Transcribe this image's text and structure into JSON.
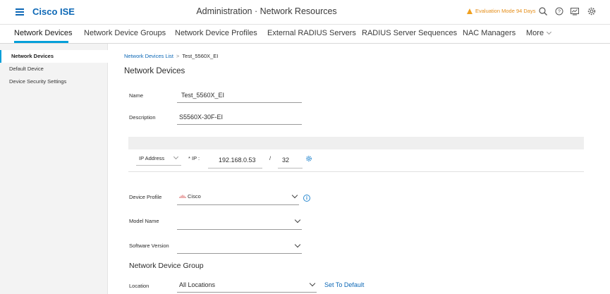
{
  "header": {
    "brand": "Cisco ISE",
    "title": "Administration · Network Resources",
    "eval_text": "Evaluation Mode 94 Days",
    "icons": [
      "search-icon",
      "help-icon",
      "dashboard-icon",
      "settings-icon"
    ],
    "accent": "#049fd9",
    "brand_color": "#0d68b6",
    "warning_color": "#e58d17"
  },
  "tabs": {
    "items": [
      {
        "label": "Network Devices",
        "active": true
      },
      {
        "label": "Network Device Groups"
      },
      {
        "label": "Network Device Profiles"
      },
      {
        "label": "External RADIUS Servers"
      },
      {
        "label": "RADIUS Server Sequences"
      },
      {
        "label": "NAC Managers"
      },
      {
        "label": "More"
      }
    ]
  },
  "sidebar": {
    "items": [
      {
        "label": "Network Devices",
        "active": true
      },
      {
        "label": "Default Device"
      },
      {
        "label": "Device Security Settings"
      }
    ]
  },
  "breadcrumb": {
    "link": "Network Devices List",
    "separator": ">",
    "current": "Test_5560X_EI"
  },
  "page": {
    "title": "Network Devices"
  },
  "form": {
    "name": {
      "label": "Name",
      "value": "Test_5560X_EI"
    },
    "description": {
      "label": "Description",
      "value": "S5560X-30F-EI"
    },
    "ip": {
      "type_value": "IP Address",
      "ip_label": "* IP :",
      "ip_value": "192.168.0.53",
      "slash": "/",
      "mask_value": "32"
    },
    "device_profile": {
      "label": "Device Profile",
      "value": "Cisco"
    },
    "model_name": {
      "label": "Model Name",
      "value": ""
    },
    "software_version": {
      "label": "Software Version",
      "value": ""
    },
    "ndg": {
      "title": "Network Device Group"
    },
    "location": {
      "label": "Location",
      "value": "All Locations",
      "action": "Set To Default"
    }
  }
}
